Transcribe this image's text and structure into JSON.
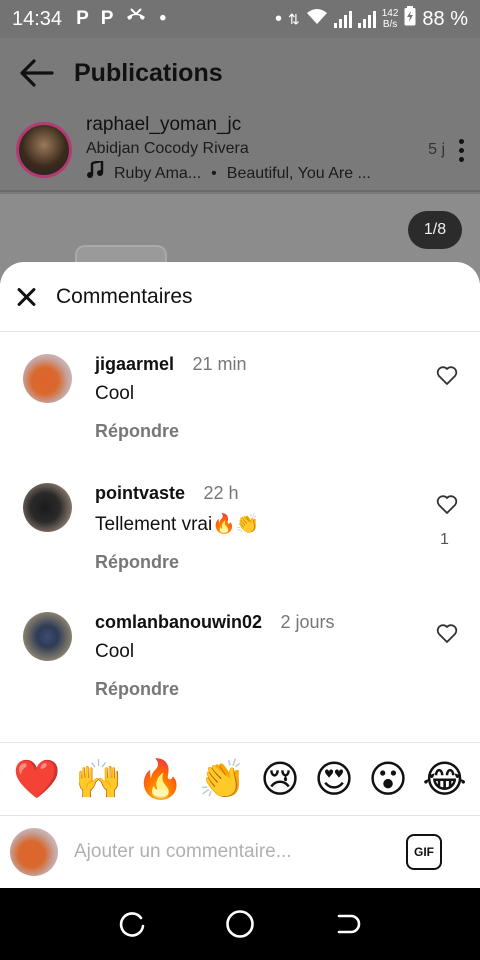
{
  "status_bar": {
    "time": "14:34",
    "net_speed_value": "142",
    "net_speed_unit": "B/s",
    "battery": "88 %"
  },
  "background_post": {
    "page_title": "Publications",
    "author_name": "raphael_yoman_jc",
    "location": "Abidjan Cocody Rivera",
    "music_artist": "Ruby Ama...",
    "music_title": "Beautiful, You Are ...",
    "posted_ago": "5 j",
    "page_counter": "1/8"
  },
  "sheet": {
    "title": "Commentaires",
    "comments": [
      {
        "username": "jigaarmel",
        "time": "21 min",
        "text": "Cool",
        "reply_label": "Répondre",
        "likes": ""
      },
      {
        "username": "pointvaste",
        "time": "22 h",
        "text": "Tellement vrai🔥👏",
        "reply_label": "Répondre",
        "likes": "1"
      },
      {
        "username": "comlanbanouwin02",
        "time": "2 jours",
        "text": "Cool",
        "reply_label": "Répondre",
        "likes": ""
      }
    ],
    "quick_emojis": [
      "❤️",
      "🙌",
      "🔥",
      "👏",
      "😢",
      "😍",
      "😮",
      "😂"
    ],
    "composer": {
      "placeholder": "Ajouter un commentaire...",
      "gif_label": "GIF"
    }
  },
  "colors": {
    "overlay": "#737373",
    "sheet_bg": "#ffffff",
    "muted_text": "#777777"
  },
  "icons": [
    "back-arrow-icon",
    "close-icon",
    "heart-icon",
    "music-note-icon",
    "more-options-icon",
    "gif-icon",
    "recents-icon",
    "home-icon",
    "back-nav-icon"
  ]
}
